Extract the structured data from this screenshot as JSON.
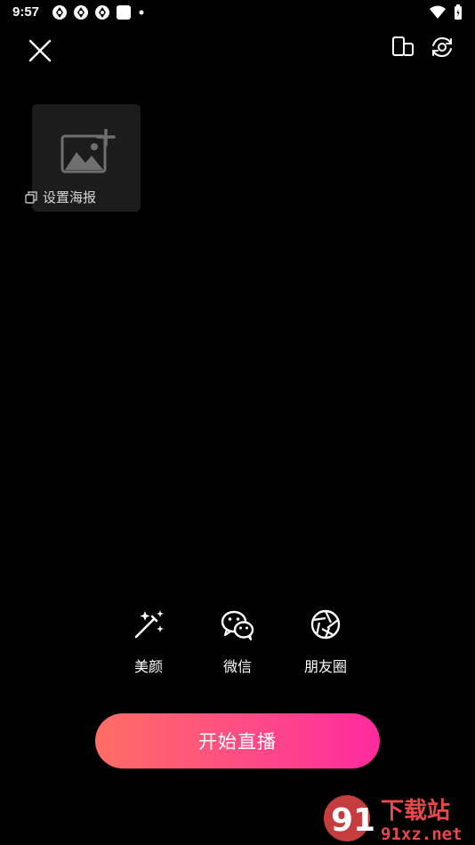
{
  "status_bar": {
    "time": "9:57"
  },
  "poster": {
    "label": "设置海报"
  },
  "options": [
    {
      "label": "美颜",
      "icon": "magic-wand-icon"
    },
    {
      "label": "微信",
      "icon": "wechat-icon"
    },
    {
      "label": "朋友圈",
      "icon": "moments-shutter-icon"
    }
  ],
  "start_button": {
    "label": "开始直播"
  },
  "watermark": {
    "title": "下载站",
    "url": "91xz.net"
  },
  "colors": {
    "accent_start": "#ff6d64",
    "accent_end": "#ff2a9e",
    "background": "#000000",
    "card": "#1c1c1c"
  }
}
